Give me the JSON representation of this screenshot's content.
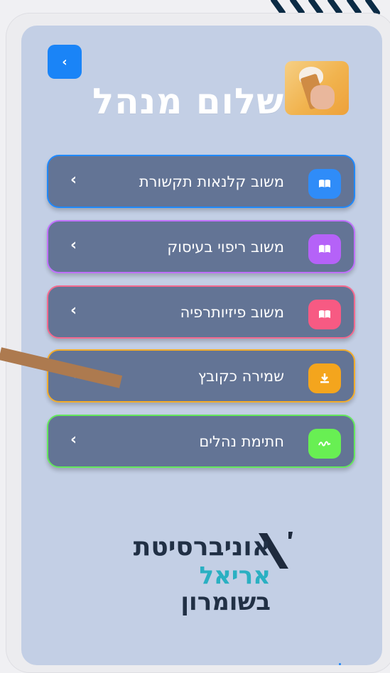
{
  "header": {
    "back_glyph": "‹",
    "greeting": "שלום מנהל",
    "avatar_icon": "ice-cream-photo"
  },
  "menu": {
    "items": [
      {
        "label": "משוב קלנאות תקשורת",
        "icon": "book-icon",
        "icon_glyph": "📖",
        "accent": "#2f8cf8",
        "border": "#1f89ff"
      },
      {
        "label": "משוב ריפוי בעיסוק",
        "icon": "book-icon",
        "icon_glyph": "📖",
        "accent": "#b562f8",
        "border": "#c071ff"
      },
      {
        "label": "משוב פיזיותרפיה",
        "icon": "book-icon",
        "icon_glyph": "📖",
        "accent": "#f75a83",
        "border": "#f46a8f"
      },
      {
        "label": "שמירה כקובץ",
        "icon": "download-icon",
        "icon_glyph": "⬇",
        "accent": "#f4a51d",
        "border": "#f3ad2b"
      },
      {
        "label": "חתימת נהלים",
        "icon": "signature-icon",
        "icon_glyph": "✍",
        "accent": "#68ef53",
        "border": "#64e85d"
      }
    ],
    "chevron": "‹"
  },
  "logo": {
    "line1": "אוניברסיטת",
    "line2": "אריאל",
    "line3": "בשומרון"
  },
  "colors": {
    "screen_bg": "#c3cfe5",
    "card_bg": "#637495",
    "back_button": "#1a84f7"
  }
}
